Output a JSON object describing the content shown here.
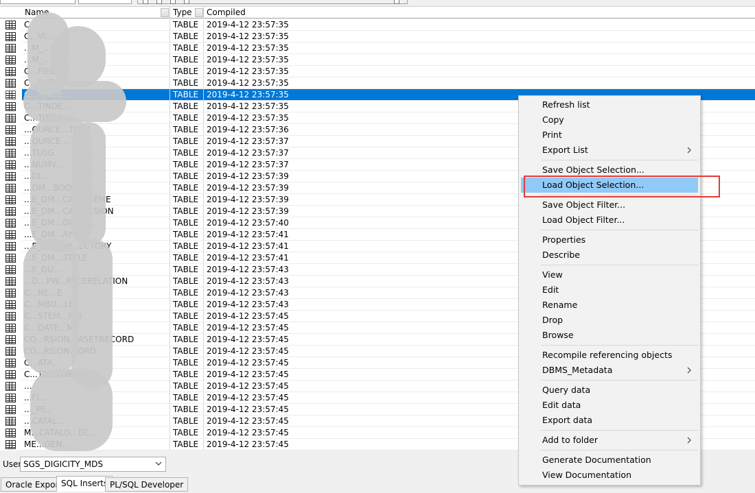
{
  "grid": {
    "columns": [
      "Name",
      "Type",
      "Compiled"
    ],
    "rows": [
      {
        "name": "C",
        "type": "TABLE",
        "compiled": "2019-4-12 23:57:35"
      },
      {
        "name": "C...VI...",
        "type": "TABLE",
        "compiled": "2019-4-12 23:57:35"
      },
      {
        "name": "...M_...ORY",
        "type": "TABLE",
        "compiled": "2019-4-12 23:57:35"
      },
      {
        "name": "...M_...EDI...",
        "type": "TABLE",
        "compiled": "2019-4-12 23:57:35"
      },
      {
        "name": "C...FIEL...",
        "type": "TABLE",
        "compiled": "2019-4-12 23:57:35"
      },
      {
        "name": "C...FILTI...",
        "type": "TABLE",
        "compiled": "2019-4-12 23:57:35"
      },
      {
        "name": "C...TINDE...",
        "type": "TABLE",
        "compiled": "2019-4-12 23:57:35",
        "selected": true
      },
      {
        "name": "C...TINDE...",
        "type": "TABLE",
        "compiled": "2019-4-12 23:57:35"
      },
      {
        "name": "C...TINFO",
        "type": "TABLE",
        "compiled": "2019-4-12 23:57:35"
      },
      {
        "name": "...OURCE...TORY",
        "type": "TABLE",
        "compiled": "2019-4-12 23:57:36"
      },
      {
        "name": "...OURCE...",
        "type": "TABLE",
        "compiled": "2019-4-12 23:57:37"
      },
      {
        "name": "...TLOG",
        "type": "TABLE",
        "compiled": "2019-4-12 23:57:37"
      },
      {
        "name": "...NUMV...",
        "type": "TABLE",
        "compiled": "2019-4-12 23:57:37"
      },
      {
        "name": "...DI...",
        "type": "TABLE",
        "compiled": "2019-4-12 23:57:39"
      },
      {
        "name": "...DM...BOOKM...",
        "type": "TABLE",
        "compiled": "2019-4-12 23:57:39"
      },
      {
        "name": "...E_DM...CACH...EME",
        "type": "TABLE",
        "compiled": "2019-4-12 23:57:39"
      },
      {
        "name": "...E_DM...CACH...SION",
        "type": "TABLE",
        "compiled": "2019-4-12 23:57:39"
      },
      {
        "name": "...E_DM...DIREC...",
        "type": "TABLE",
        "compiled": "2019-4-12 23:57:40"
      },
      {
        "name": "...E_DM...AYE...",
        "type": "TABLE",
        "compiled": "2019-4-12 23:57:41"
      },
      {
        "name": "...E_DM...AY...ECTORY",
        "type": "TABLE",
        "compiled": "2019-4-12 23:57:41"
      },
      {
        "name": "...E_DM...STYLE",
        "type": "TABLE",
        "compiled": "2019-4-12 23:57:41"
      },
      {
        "name": "...E_DU...",
        "type": "TABLE",
        "compiled": "2019-4-12 23:57:43"
      },
      {
        "name": "...D...PW...PACERELATION",
        "type": "TABLE",
        "compiled": "2019-4-12 23:57:43"
      },
      {
        "name": "C...NE...E",
        "type": "TABLE",
        "compiled": "2019-4-12 23:57:43"
      },
      {
        "name": "C...MBO...LE",
        "type": "TABLE",
        "compiled": "2019-4-12 23:57:43"
      },
      {
        "name": "C...STEM...FIG",
        "type": "TABLE",
        "compiled": "2019-4-12 23:57:45"
      },
      {
        "name": "C...DATE...ME",
        "type": "TABLE",
        "compiled": "2019-4-12 23:57:45"
      },
      {
        "name": "CO...RSION...ASETRECORD",
        "type": "TABLE",
        "compiled": "2019-4-12 23:57:45"
      },
      {
        "name": "CO...RSION...ORD",
        "type": "TABLE",
        "compiled": "2019-4-12 23:57:45"
      },
      {
        "name": "C...ATA...",
        "type": "TABLE",
        "compiled": "2019-4-12 23:57:45"
      },
      {
        "name": "C...TA...TORY",
        "type": "TABLE",
        "compiled": "2019-4-12 23:57:45"
      },
      {
        "name": "...",
        "type": "TABLE",
        "compiled": "2019-4-12 23:57:45"
      },
      {
        "name": "...FI...",
        "type": "TABLE",
        "compiled": "2019-4-12 23:57:45"
      },
      {
        "name": "..._PF...",
        "type": "TABLE",
        "compiled": "2019-4-12 23:57:45"
      },
      {
        "name": "...CATAL...",
        "type": "TABLE",
        "compiled": "2019-4-12 23:57:45"
      },
      {
        "name": "M...CATALO...EC...",
        "type": "TABLE",
        "compiled": "2019-4-12 23:57:45"
      },
      {
        "name": "ME...GEN...",
        "type": "TABLE",
        "compiled": "2019-4-12 23:57:45"
      }
    ]
  },
  "user_bar": {
    "label": "User",
    "selected_user": "SGS_DIGICITY_MDS"
  },
  "tabs": [
    {
      "label": "Oracle Export",
      "active": false
    },
    {
      "label": "SQL Inserts",
      "active": true
    },
    {
      "label": "PL/SQL Developer",
      "active": false
    }
  ],
  "context_menu": {
    "items": [
      {
        "label": "Refresh list",
        "submenu": false
      },
      {
        "label": "Copy",
        "submenu": false
      },
      {
        "label": "Print",
        "submenu": false
      },
      {
        "label": "Export List",
        "submenu": true
      },
      {
        "separator": true
      },
      {
        "label": "Save Object Selection...",
        "submenu": false
      },
      {
        "label": "Load Object Selection...",
        "submenu": false,
        "highlighted": true
      },
      {
        "separator": true
      },
      {
        "label": "Save Object Filter...",
        "submenu": false
      },
      {
        "label": "Load Object Filter...",
        "submenu": false
      },
      {
        "separator": true
      },
      {
        "label": "Properties",
        "submenu": false
      },
      {
        "label": "Describe",
        "submenu": false
      },
      {
        "separator": true
      },
      {
        "label": "View",
        "submenu": false
      },
      {
        "label": "Edit",
        "submenu": false
      },
      {
        "label": "Rename",
        "submenu": false
      },
      {
        "label": "Drop",
        "submenu": false
      },
      {
        "label": "Browse",
        "submenu": false
      },
      {
        "separator": true
      },
      {
        "label": "Recompile referencing objects",
        "submenu": false
      },
      {
        "label": "DBMS_Metadata",
        "submenu": true
      },
      {
        "separator": true
      },
      {
        "label": "Query data",
        "submenu": false
      },
      {
        "label": "Edit data",
        "submenu": false
      },
      {
        "label": "Export data",
        "submenu": false
      },
      {
        "separator": true
      },
      {
        "label": "Add to folder",
        "submenu": true
      },
      {
        "separator": true
      },
      {
        "label": "Generate Documentation",
        "submenu": false
      },
      {
        "label": "View Documentation",
        "submenu": false
      }
    ]
  },
  "colors": {
    "selection": "#0078d7",
    "menu_hover": "#91c9f7",
    "annotation_box": "#e53935"
  },
  "icons": {
    "row_icon": "table-icon",
    "submenu_arrow": "chevron-right-icon",
    "dropdown_arrow": "chevron-down-icon"
  }
}
